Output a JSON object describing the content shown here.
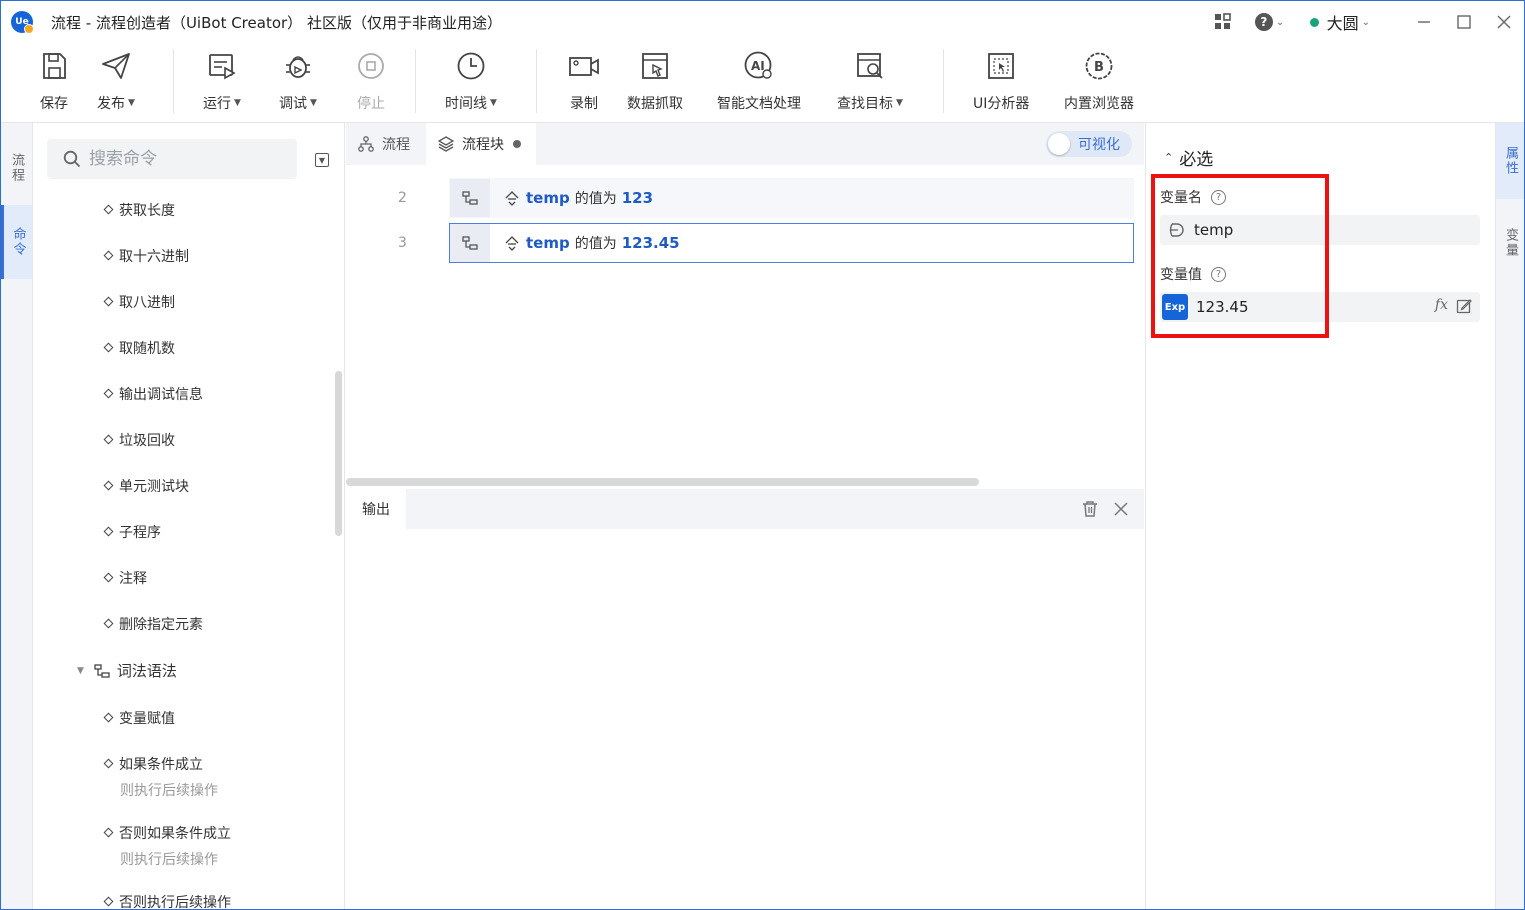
{
  "window": {
    "title": "流程 - 流程创造者（UiBot Creator） 社区版（仅用于非商业用途）",
    "user": "大圆",
    "logo_text": "Ue"
  },
  "toolbar": {
    "save": "保存",
    "publish": "发布",
    "run": "运行",
    "debug": "调试",
    "stop": "停止",
    "timeline": "时间线",
    "record": "录制",
    "data_scrape": "数据抓取",
    "smart_doc": "智能文档处理",
    "find_target": "查找目标",
    "ui_analyzer": "UI分析器",
    "builtin_browser": "内置浏览器"
  },
  "left_tabs": {
    "flow": "流程",
    "command": "命令"
  },
  "command_panel": {
    "search_placeholder": "搜索命令",
    "items": [
      {
        "label": "获取长度"
      },
      {
        "label": "取十六进制"
      },
      {
        "label": "取八进制"
      },
      {
        "label": "取随机数"
      },
      {
        "label": "输出调试信息"
      },
      {
        "label": "垃圾回收"
      },
      {
        "label": "单元测试块"
      },
      {
        "label": "子程序"
      },
      {
        "label": "注释"
      },
      {
        "label": "删除指定元素"
      }
    ],
    "group": "词法语法",
    "group_items": [
      {
        "label": "变量赋值",
        "sub": ""
      },
      {
        "label": "如果条件成立",
        "sub": "则执行后续操作"
      },
      {
        "label": "否则如果条件成立",
        "sub": "则执行后续操作"
      },
      {
        "label": "否则执行后续操作",
        "sub": ""
      }
    ]
  },
  "editor": {
    "tabs": [
      {
        "label": "流程"
      },
      {
        "label": "流程块"
      }
    ],
    "visual_toggle": "可视化",
    "rows": [
      {
        "line": "2",
        "var": "temp",
        "text": "的值为",
        "value": "123"
      },
      {
        "line": "3",
        "var": "temp",
        "text": "的值为",
        "value": "123.45"
      }
    ],
    "output_tab": "输出"
  },
  "properties": {
    "section": "必选",
    "var_name_label": "变量名",
    "var_name_value": "temp",
    "var_value_label": "变量值",
    "var_value_badge": "Exp",
    "var_value_value": "123.45",
    "fx": "fx"
  },
  "right_tabs": {
    "attributes": "属性",
    "variables": "变量"
  },
  "colors": {
    "accent": "#1565d8",
    "highlight": "#ee1111",
    "keyword": "#1f5bc5"
  }
}
